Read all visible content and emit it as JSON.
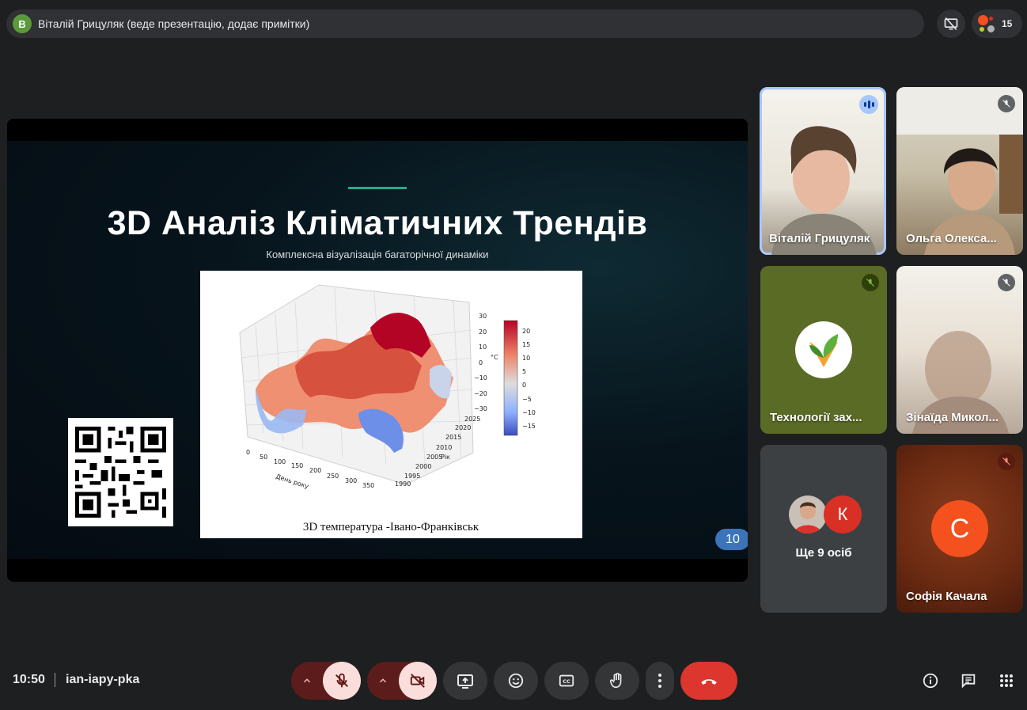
{
  "presenter_bar": {
    "avatar_letter": "В",
    "title": "Віталій Грицуляк (веде презентацію, додає примітки)"
  },
  "participants_count": "15",
  "slide": {
    "title": "3D Аналіз Кліматичних Трендів",
    "subtitle": "Комплексна візуалізація багаторічної динаміки",
    "chart_caption": "3D температура -Івано-Франківськ",
    "chart_axis_day": "День року",
    "chart_axis_year": "Рік",
    "chart_unit": "°C",
    "page_number": "10",
    "day_ticks": [
      "0",
      "50",
      "100",
      "150",
      "200",
      "250",
      "300",
      "350"
    ],
    "year_ticks": [
      "1990",
      "1995",
      "2000",
      "2005",
      "2010",
      "2015",
      "2020",
      "2025"
    ],
    "z_ticks": [
      "30",
      "20",
      "10",
      "0",
      "−10",
      "−20",
      "−30"
    ],
    "colorbar_ticks": [
      "20",
      "15",
      "10",
      "5",
      "0",
      "−5",
      "−10",
      "−15"
    ]
  },
  "tiles": [
    {
      "name": "Віталій Грицуляк",
      "state": "speaking"
    },
    {
      "name": "Ольга Олекса...",
      "state": "muted"
    },
    {
      "name": "Технології зах...",
      "state": "muted"
    },
    {
      "name": "Зінаїда Микол...",
      "state": "muted"
    },
    {
      "name": "Ще 9 осіб",
      "others_letter": "К"
    },
    {
      "name": "Софія Качала",
      "letter": "С",
      "state": "muted"
    }
  ],
  "bottom": {
    "time": "10:50",
    "meeting_code": "ian-iapy-pka"
  },
  "colors": {
    "accent": "#27a98a",
    "end_call": "#dc362e",
    "avatar_orange": "#f4511e",
    "avatar_k": "#d93025"
  }
}
